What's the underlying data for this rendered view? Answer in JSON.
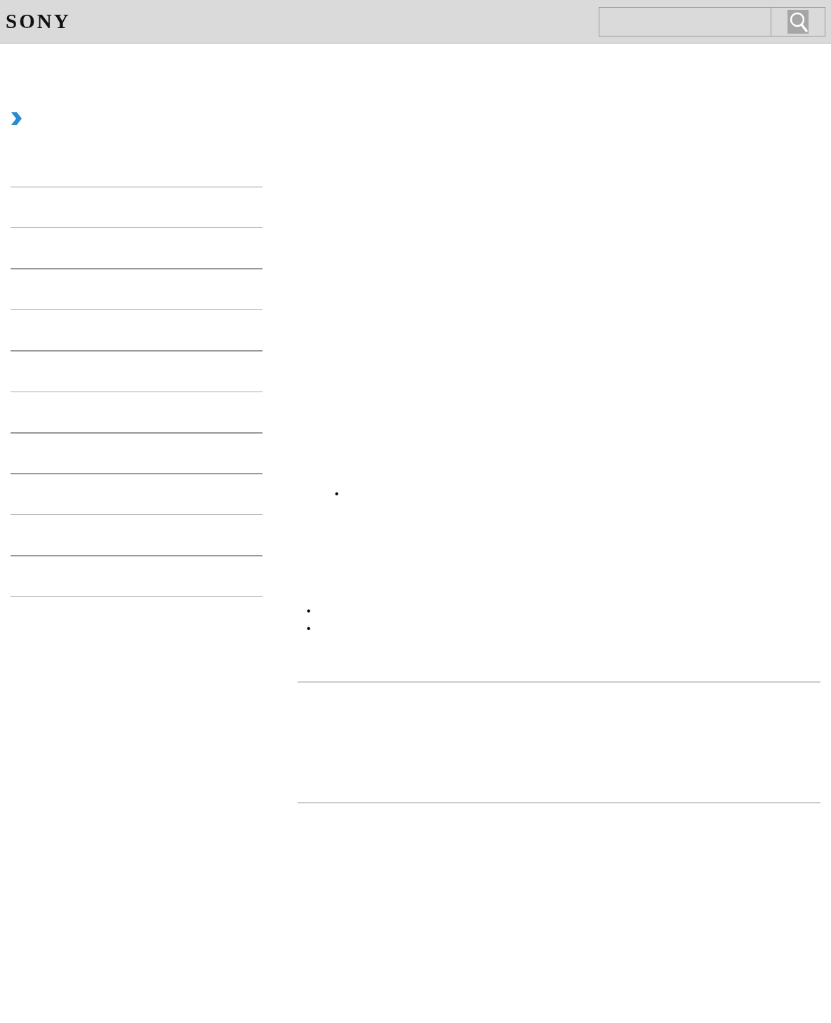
{
  "header": {
    "logo": "SONY"
  },
  "content": {
    "nested_bullet": "•",
    "bullets": [
      "•",
      "•"
    ]
  }
}
